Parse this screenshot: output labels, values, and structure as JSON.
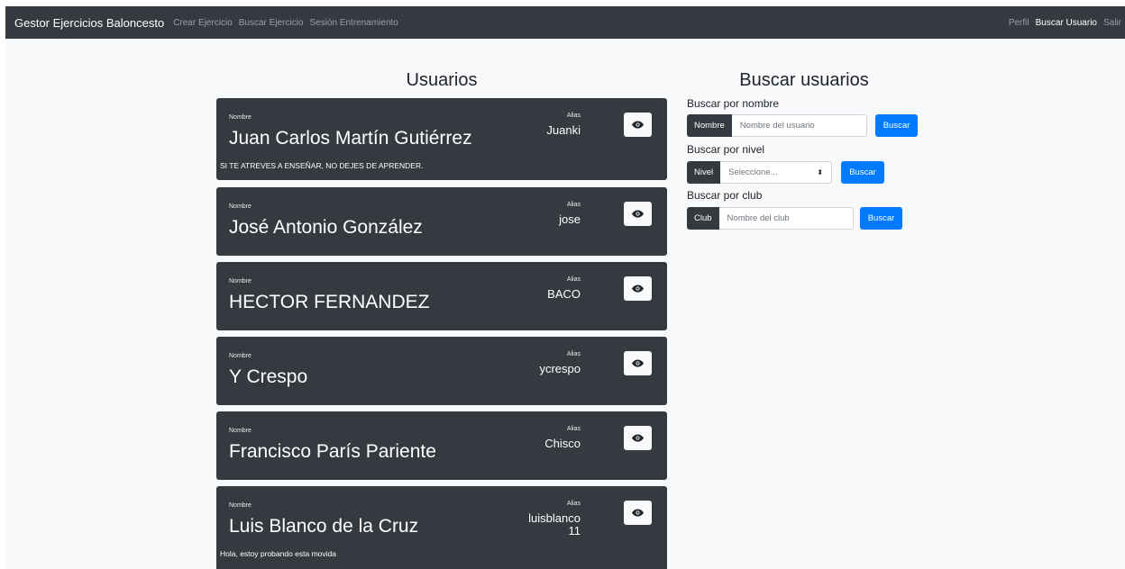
{
  "navbar": {
    "brand": "Gestor Ejercicios Baloncesto",
    "links": [
      "Crear Ejercicio",
      "Buscar Ejercicio",
      "Sesión Entrenamiento"
    ],
    "right_links": [
      "Perfil",
      "Buscar Usuario",
      "Salir"
    ],
    "active_right": "Buscar Usuario"
  },
  "users_title": "Usuarios",
  "users": [
    {
      "name_label": "Nombre",
      "name": "Juan Carlos Martín Gutiérrez",
      "alias_label": "Alias",
      "alias": "Juanki",
      "description": "SI TE ATREVES A ENSEÑAR, NO DEJES DE APRENDER.",
      "view_icon": "eye-icon"
    },
    {
      "name_label": "Nombre",
      "name": "José Antonio González",
      "alias_label": "Alias",
      "alias": "jose",
      "description": "",
      "view_icon": "eye-icon"
    },
    {
      "name_label": "Nombre",
      "name": "HECTOR FERNANDEZ",
      "alias_label": "Alias",
      "alias": "BACO",
      "description": "",
      "view_icon": "eye-icon"
    },
    {
      "name_label": "Nombre",
      "name": "Y Crespo",
      "alias_label": "Alias",
      "alias": "ycrespo",
      "description": "",
      "view_icon": "eye-icon"
    },
    {
      "name_label": "Nombre",
      "name": "Francisco París Pariente",
      "alias_label": "Alias",
      "alias": "Chisco",
      "description": "",
      "view_icon": "eye-icon"
    },
    {
      "name_label": "Nombre",
      "name": "Luis Blanco de la Cruz",
      "alias_label": "Alias",
      "alias": "luisblanco 11",
      "description": "Hola, estoy probando esta movida",
      "view_icon": "eye-icon"
    }
  ],
  "search": {
    "title": "Buscar usuarios",
    "by_name": {
      "label": "Buscar por nombre",
      "prepend": "Nombre",
      "placeholder": "Nombre del usuario",
      "button": "Buscar"
    },
    "by_level": {
      "label": "Buscar por nivel",
      "prepend": "Nivel",
      "selected": "Seleccione...",
      "button": "Buscar"
    },
    "by_club": {
      "label": "Buscar por club",
      "prepend": "Club",
      "placeholder": "Nombre del club",
      "button": "Buscar"
    }
  },
  "colors": {
    "navbar": "#343a40",
    "card": "#343a40",
    "primary": "#007bff",
    "background": "#f8f9fa"
  }
}
